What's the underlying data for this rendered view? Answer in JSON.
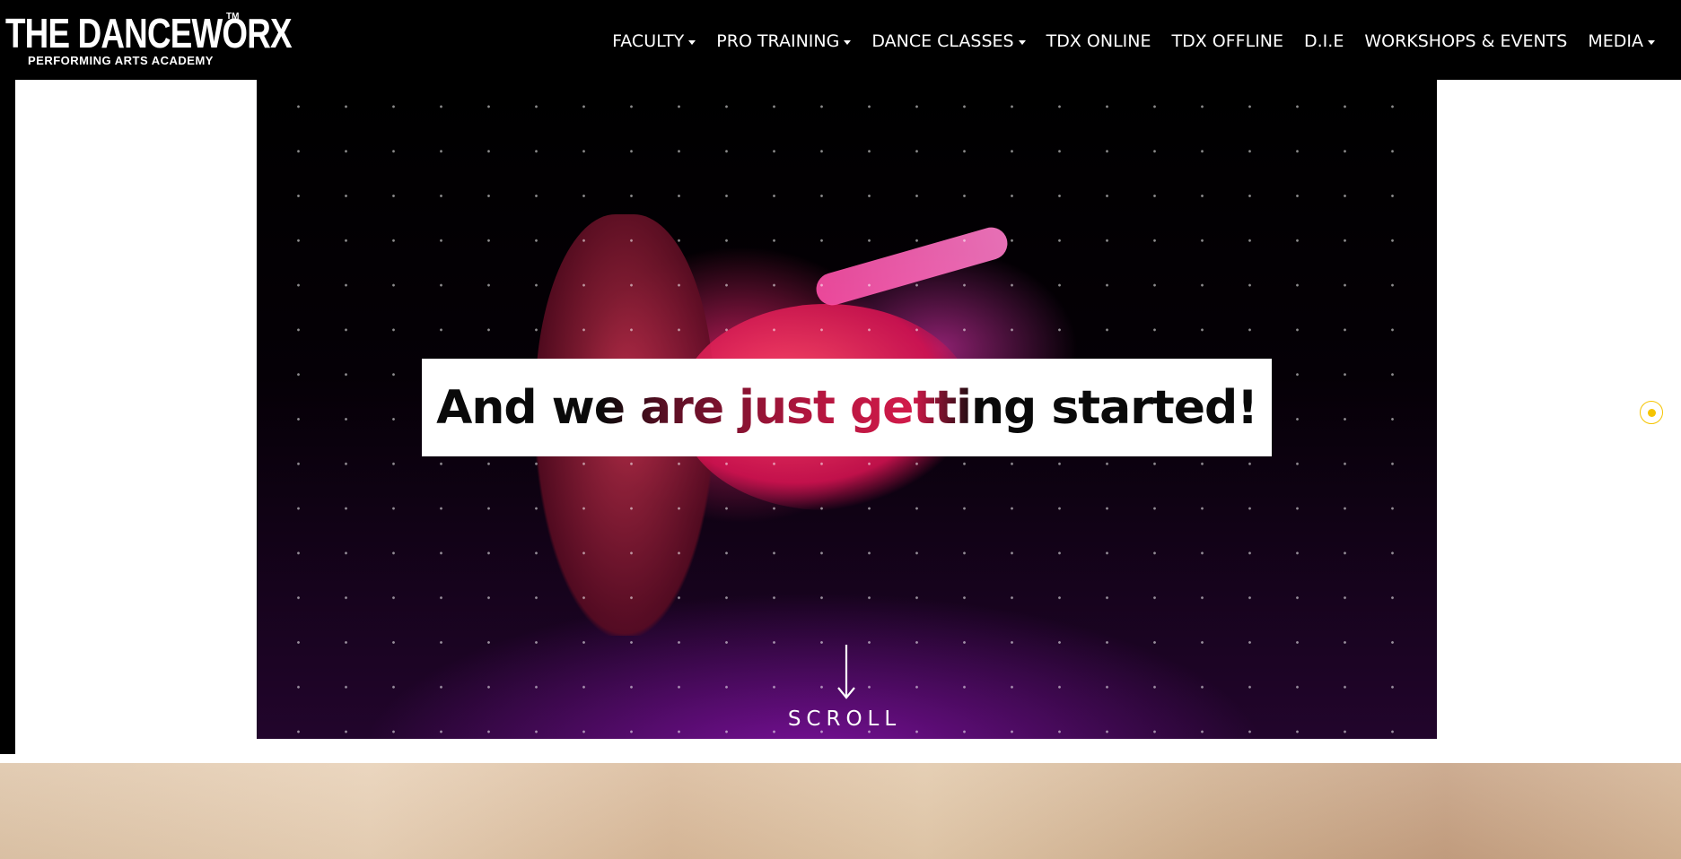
{
  "brand": {
    "logo_main": "THE DANCEWORX",
    "logo_tm": "TM",
    "logo_sub": "PERFORMING ARTS ACADEMY"
  },
  "nav": {
    "items": [
      {
        "label": "FACULTY",
        "has_dropdown": true
      },
      {
        "label": "PRO TRAINING",
        "has_dropdown": true
      },
      {
        "label": "DANCE CLASSES",
        "has_dropdown": true
      },
      {
        "label": "TDX ONLINE",
        "has_dropdown": false
      },
      {
        "label": "TDX OFFLINE",
        "has_dropdown": false
      },
      {
        "label": "D.I.E",
        "has_dropdown": false
      },
      {
        "label": "WORKSHOPS & EVENTS",
        "has_dropdown": false
      },
      {
        "label": "MEDIA",
        "has_dropdown": true
      }
    ]
  },
  "hero": {
    "headline": "And we are just getting started!",
    "scroll_label": "SCROLL",
    "scroll_icon": "arrow-down-icon"
  },
  "side_nav": {
    "icon": "nav-dot-icon",
    "accent_color": "#f5c400"
  },
  "colors": {
    "topbar": "#000000",
    "headline_accent": "#d21a4a"
  }
}
